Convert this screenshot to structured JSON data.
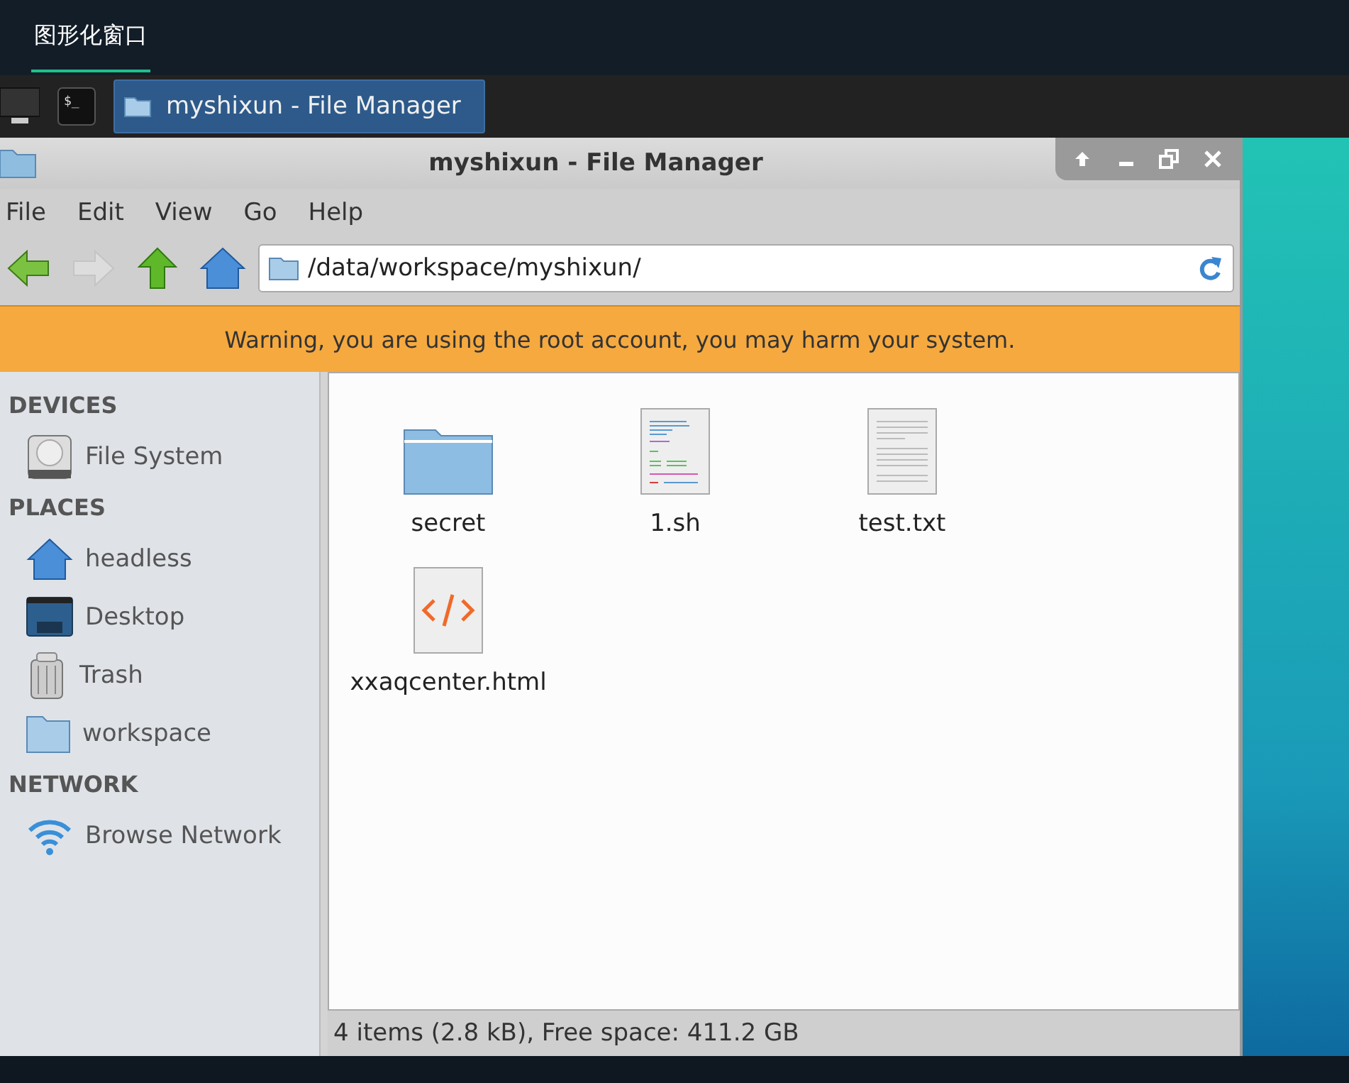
{
  "top_tab": {
    "label": "图形化窗口",
    "selected": true
  },
  "taskbar": {
    "terminal_glyph": "$_",
    "window_button": {
      "label": "myshixun - File Manager",
      "selected": true
    }
  },
  "window": {
    "title": "myshixun - File Manager"
  },
  "menu": [
    "File",
    "Edit",
    "View",
    "Go",
    "Help"
  ],
  "location": {
    "path": "/data/workspace/myshixun/"
  },
  "warning": "Warning, you are using the root account, you may harm your system.",
  "sidebar": [
    {
      "heading": "DEVICES",
      "items": [
        {
          "label": "File System",
          "kind": "drive"
        }
      ]
    },
    {
      "heading": "PLACES",
      "items": [
        {
          "label": "headless",
          "kind": "home"
        },
        {
          "label": "Desktop",
          "kind": "desktop"
        },
        {
          "label": "Trash",
          "kind": "trash"
        },
        {
          "label": "workspace",
          "kind": "folder"
        }
      ]
    },
    {
      "heading": "NETWORK",
      "items": [
        {
          "label": "Browse Network",
          "kind": "network"
        }
      ]
    }
  ],
  "files": [
    {
      "name": "secret",
      "kind": "folder"
    },
    {
      "name": "1.sh",
      "kind": "script"
    },
    {
      "name": "test.txt",
      "kind": "text"
    },
    {
      "name": "xxaqcenter.html",
      "kind": "html"
    }
  ],
  "status_bar": "4 items (2.8 kB), Free space: 411.2 GB"
}
